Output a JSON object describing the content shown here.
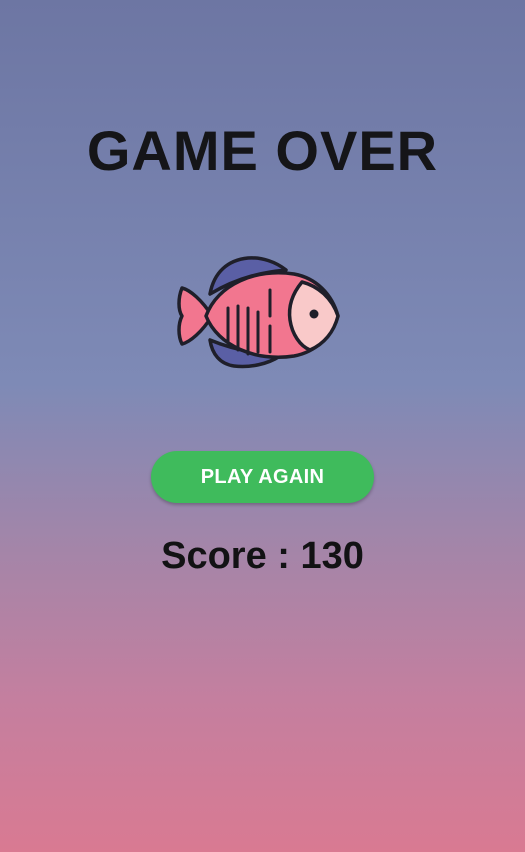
{
  "game_over": {
    "title": "GAME OVER",
    "mascot_icon": "fish-icon",
    "play_again_label": "PLAY AGAIN",
    "score_text": "Score : 130"
  },
  "colors": {
    "button": "#3fbb5c",
    "fish_body": "#f2768f",
    "fish_fin": "#5a5fa5",
    "gradient_top": "#6d76a3",
    "gradient_bottom": "#d97a92"
  }
}
